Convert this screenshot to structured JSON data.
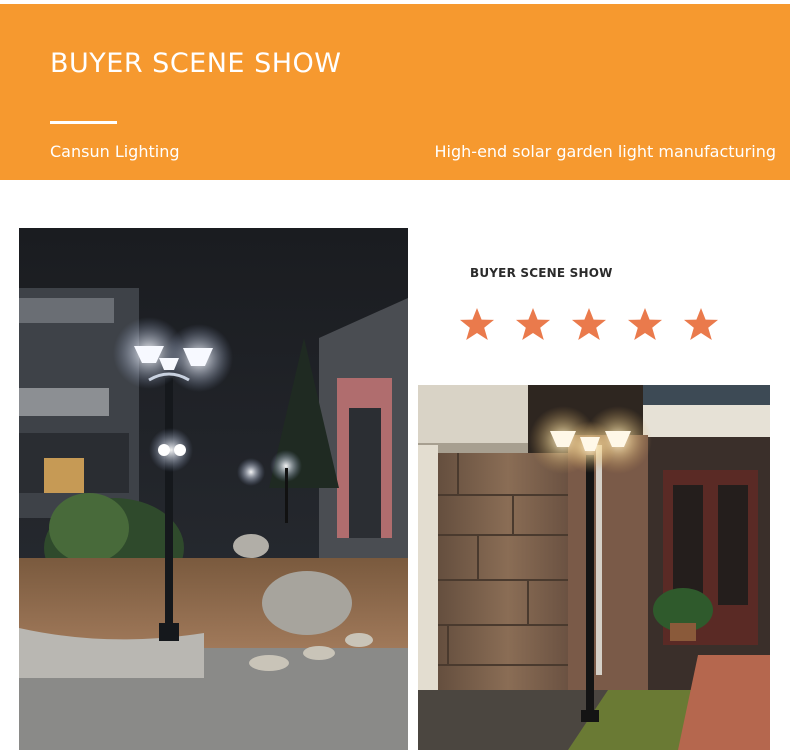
{
  "banner": {
    "title": "BUYER SCENE SHOW",
    "brand": "Cansun Lighting",
    "tagline": "High-end solar garden light manufacturing",
    "color": "#f6992f"
  },
  "section": {
    "subtitle": "BUYER SCENE SHOW",
    "rating": {
      "value": 5,
      "max": 5,
      "star_color": "#ea7a4c"
    }
  },
  "photos": {
    "left": {
      "icon": "night-garden-photo"
    },
    "right": {
      "icon": "house-entrance-photo"
    }
  }
}
